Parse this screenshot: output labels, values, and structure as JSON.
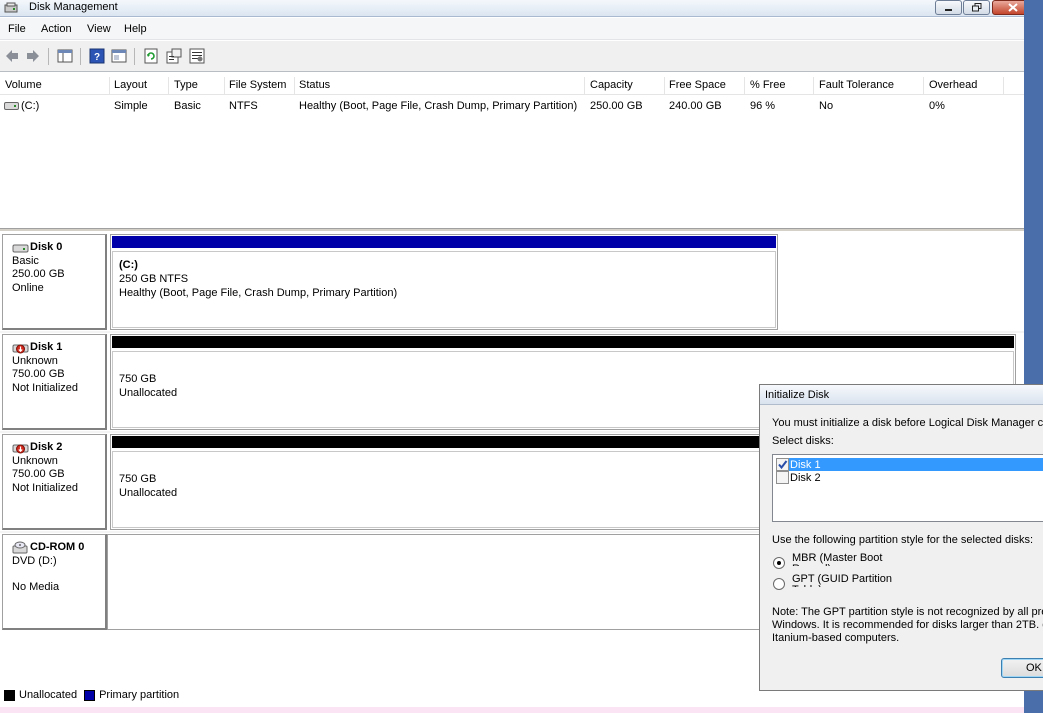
{
  "window": {
    "title": "Disk Management"
  },
  "menu": [
    "File",
    "Action",
    "View",
    "Help"
  ],
  "toolbar_icons": [
    "back-arrow-icon",
    "forward-arrow-icon",
    "console-tree-icon",
    "help-icon",
    "show-hide-pane-icon",
    "refresh-icon",
    "properties-icon",
    "settings-icon"
  ],
  "volume_table": {
    "columns": [
      "Volume",
      "Layout",
      "Type",
      "File System",
      "Status",
      "Capacity",
      "Free Space",
      "% Free",
      "Fault Tolerance",
      "Overhead"
    ],
    "rows": [
      {
        "volume": "(C:)",
        "layout": "Simple",
        "type": "Basic",
        "file_system": "NTFS",
        "status": "Healthy (Boot, Page File, Crash Dump, Primary Partition)",
        "capacity": "250.00 GB",
        "free_space": "240.00 GB",
        "pct_free": "96 %",
        "fault_tolerance": "No",
        "overhead": "0%"
      }
    ]
  },
  "disks": [
    {
      "name": "Disk 0",
      "type": "Basic",
      "size": "250.00 GB",
      "state": "Online",
      "partition": {
        "title": "(C:)",
        "line1": "250 GB NTFS",
        "line2": "Healthy (Boot, Page File, Crash Dump, Primary Partition)",
        "color": "#0000a8"
      }
    },
    {
      "name": "Disk 1",
      "type": "Unknown",
      "size": "750.00 GB",
      "state": "Not Initialized",
      "partition": {
        "line1": "750 GB",
        "line2": "Unallocated",
        "color": "#000000"
      }
    },
    {
      "name": "Disk 2",
      "type": "Unknown",
      "size": "750.00 GB",
      "state": "Not Initialized",
      "partition": {
        "line1": "750 GB",
        "line2": "Unallocated",
        "color": "#000000"
      }
    },
    {
      "name": "CD-ROM 0",
      "type": "DVD (D:)",
      "state": "No Media"
    }
  ],
  "legend": [
    {
      "label": "Unallocated",
      "color": "#000000"
    },
    {
      "label": "Primary partition",
      "color": "#0000a8"
    }
  ],
  "dialog": {
    "title": "Initialize Disk",
    "intro": "You must initialize a disk before Logical Disk Manager can",
    "select_label": "Select disks:",
    "disks": [
      {
        "label": "Disk 1",
        "checked": true,
        "selected": true
      },
      {
        "label": "Disk 2",
        "checked": false,
        "selected": false
      }
    ],
    "partition_style_label": "Use the following partition style for the selected disks:",
    "options": [
      {
        "label": "MBR (Master Boot Record)",
        "selected": true
      },
      {
        "label": "GPT (GUID Partition Table)",
        "selected": false
      }
    ],
    "note": "Note: The GPT partition style is not recognized by all prev\nWindows. It is recommended for disks larger than 2TB. o\nItanium-based computers.",
    "ok_label": "OK"
  }
}
